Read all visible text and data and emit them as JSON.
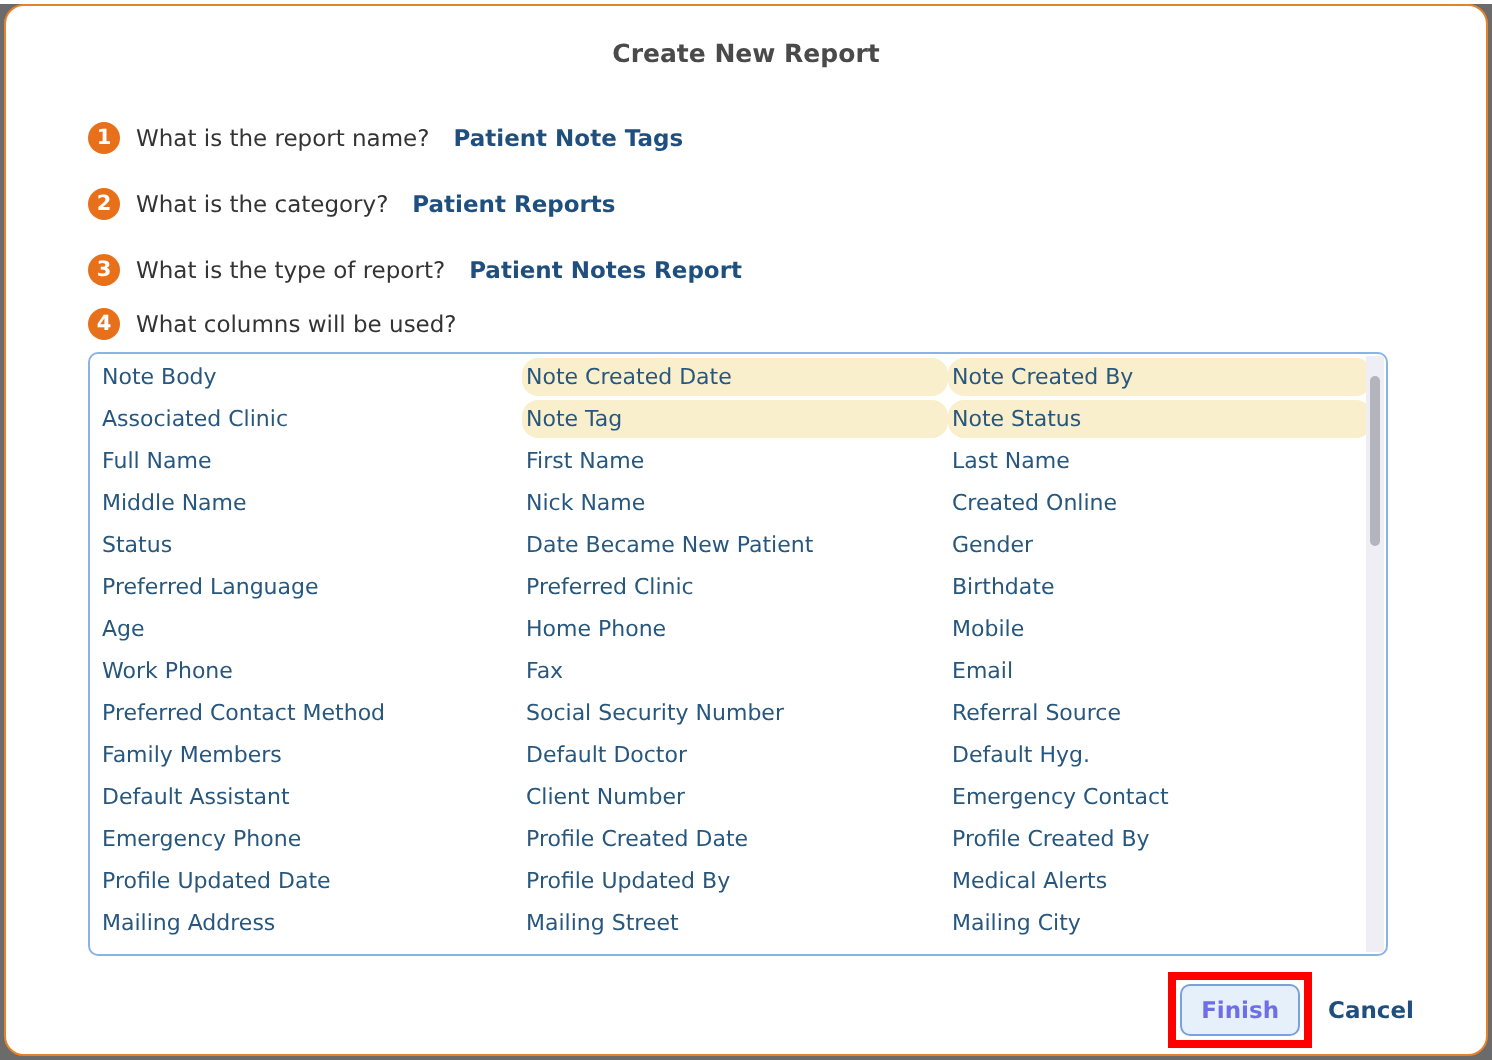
{
  "dialog": {
    "title": "Create New Report"
  },
  "questions": [
    {
      "number": "1",
      "text": "What is the report name?",
      "answer": "Patient Note Tags"
    },
    {
      "number": "2",
      "text": "What is the category?",
      "answer": "Patient Reports"
    },
    {
      "number": "3",
      "text": "What is the type of report?",
      "answer": "Patient Notes Report"
    },
    {
      "number": "4",
      "text": "What columns will be used?"
    }
  ],
  "columns": [
    {
      "label": "Note Body",
      "selected": false
    },
    {
      "label": "Note Created Date",
      "selected": true
    },
    {
      "label": "Note Created By",
      "selected": true
    },
    {
      "label": "Associated Clinic",
      "selected": false
    },
    {
      "label": "Note Tag",
      "selected": true
    },
    {
      "label": "Note Status",
      "selected": true
    },
    {
      "label": "Full Name",
      "selected": false
    },
    {
      "label": "First Name",
      "selected": false
    },
    {
      "label": "Last Name",
      "selected": false
    },
    {
      "label": "Middle Name",
      "selected": false
    },
    {
      "label": "Nick Name",
      "selected": false
    },
    {
      "label": "Created Online",
      "selected": false
    },
    {
      "label": "Status",
      "selected": false
    },
    {
      "label": "Date Became New Patient",
      "selected": false
    },
    {
      "label": "Gender",
      "selected": false
    },
    {
      "label": "Preferred Language",
      "selected": false
    },
    {
      "label": "Preferred Clinic",
      "selected": false
    },
    {
      "label": "Birthdate",
      "selected": false
    },
    {
      "label": "Age",
      "selected": false
    },
    {
      "label": "Home Phone",
      "selected": false
    },
    {
      "label": "Mobile",
      "selected": false
    },
    {
      "label": "Work Phone",
      "selected": false
    },
    {
      "label": "Fax",
      "selected": false
    },
    {
      "label": "Email",
      "selected": false
    },
    {
      "label": "Preferred Contact Method",
      "selected": false
    },
    {
      "label": "Social Security Number",
      "selected": false
    },
    {
      "label": "Referral Source",
      "selected": false
    },
    {
      "label": "Family Members",
      "selected": false
    },
    {
      "label": "Default Doctor",
      "selected": false
    },
    {
      "label": "Default Hyg.",
      "selected": false
    },
    {
      "label": "Default Assistant",
      "selected": false
    },
    {
      "label": "Client Number",
      "selected": false
    },
    {
      "label": "Emergency Contact",
      "selected": false
    },
    {
      "label": "Emergency Phone",
      "selected": false
    },
    {
      "label": "Profile Created Date",
      "selected": false
    },
    {
      "label": "Profile Created By",
      "selected": false
    },
    {
      "label": "Profile Updated Date",
      "selected": false
    },
    {
      "label": "Profile Updated By",
      "selected": false
    },
    {
      "label": "Medical Alerts",
      "selected": false
    },
    {
      "label": "Mailing Address",
      "selected": false
    },
    {
      "label": "Mailing Street",
      "selected": false
    },
    {
      "label": "Mailing City",
      "selected": false
    }
  ],
  "buttons": [
    {
      "label": "Finish",
      "kind": "primary",
      "highlighted": true
    },
    {
      "label": "Cancel",
      "kind": "link",
      "highlighted": false
    }
  ]
}
